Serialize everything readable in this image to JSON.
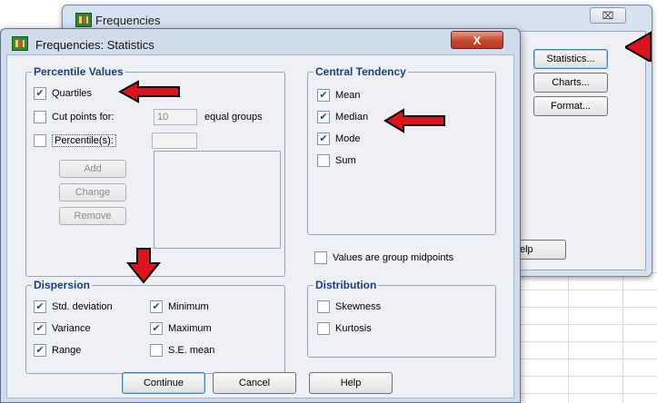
{
  "back_window": {
    "title": "Frequencies",
    "close_label": "⌧",
    "buttons": {
      "statistics": "Statistics...",
      "charts": "Charts...",
      "format": "Format...",
      "help": "elp"
    }
  },
  "dialog": {
    "title": "Frequencies: Statistics",
    "close_label": "X",
    "percentile": {
      "legend": "Percentile Values",
      "quartiles": "Quartiles",
      "cut_points": "Cut points for:",
      "cut_value": "10",
      "equal_groups": "equal groups",
      "percentiles": "Percentile(s):",
      "add": "Add",
      "change": "Change",
      "remove": "Remove"
    },
    "central": {
      "legend": "Central Tendency",
      "mean": "Mean",
      "median": "Median",
      "mode": "Mode",
      "sum": "Sum"
    },
    "midpoints": "Values are group midpoints",
    "dispersion": {
      "legend": "Dispersion",
      "std_dev": "Std. deviation",
      "variance": "Variance",
      "range": "Range",
      "minimum": "Minimum",
      "maximum": "Maximum",
      "se_mean": "S.E. mean"
    },
    "distribution": {
      "legend": "Distribution",
      "skewness": "Skewness",
      "kurtosis": "Kurtosis"
    },
    "footer": {
      "continue": "Continue",
      "cancel": "Cancel",
      "help": "Help"
    }
  },
  "checked_mark": "✔",
  "colors": {
    "arrow_red": "#e0121a",
    "legend_blue": "#1a3f7a",
    "close_red": "#c3482f"
  }
}
